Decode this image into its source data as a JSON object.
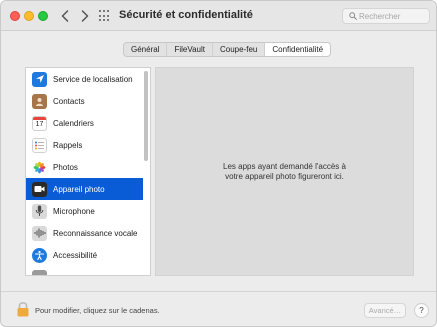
{
  "window": {
    "title": "Sécurité et confidentialité",
    "search": {
      "placeholder": "Rechercher"
    }
  },
  "tabs": [
    {
      "label": "Général"
    },
    {
      "label": "FileVault"
    },
    {
      "label": "Coupe-feu"
    },
    {
      "label": "Confidentialité",
      "active": true
    }
  ],
  "sidebar": {
    "items": [
      {
        "label": "Service de localisation",
        "icon": "location-arrow-icon"
      },
      {
        "label": "Contacts",
        "icon": "contacts-book-icon"
      },
      {
        "label": "Calendriers",
        "icon": "calendar-icon",
        "icon_text": "17"
      },
      {
        "label": "Rappels",
        "icon": "reminders-list-icon"
      },
      {
        "label": "Photos",
        "icon": "photos-flower-icon"
      },
      {
        "label": "Appareil photo",
        "icon": "camera-icon",
        "selected": true
      },
      {
        "label": "Microphone",
        "icon": "microphone-icon"
      },
      {
        "label": "Reconnaissance vocale",
        "icon": "waveform-icon"
      },
      {
        "label": "Accessibilité",
        "icon": "accessibility-icon"
      }
    ]
  },
  "content": {
    "line1": "Les apps ayant demandé l'accès à",
    "line2": "votre appareil photo figureront ici."
  },
  "footer": {
    "lock_text": "Pour modifier, cliquez sur le cadenas.",
    "advanced_label": "Avancé…",
    "help_label": "?"
  },
  "colors": {
    "selection": "#0a5cd6",
    "close": "#ff5f57",
    "minimize": "#febc2e",
    "zoom": "#28c840",
    "lock": "#f0a93b"
  }
}
